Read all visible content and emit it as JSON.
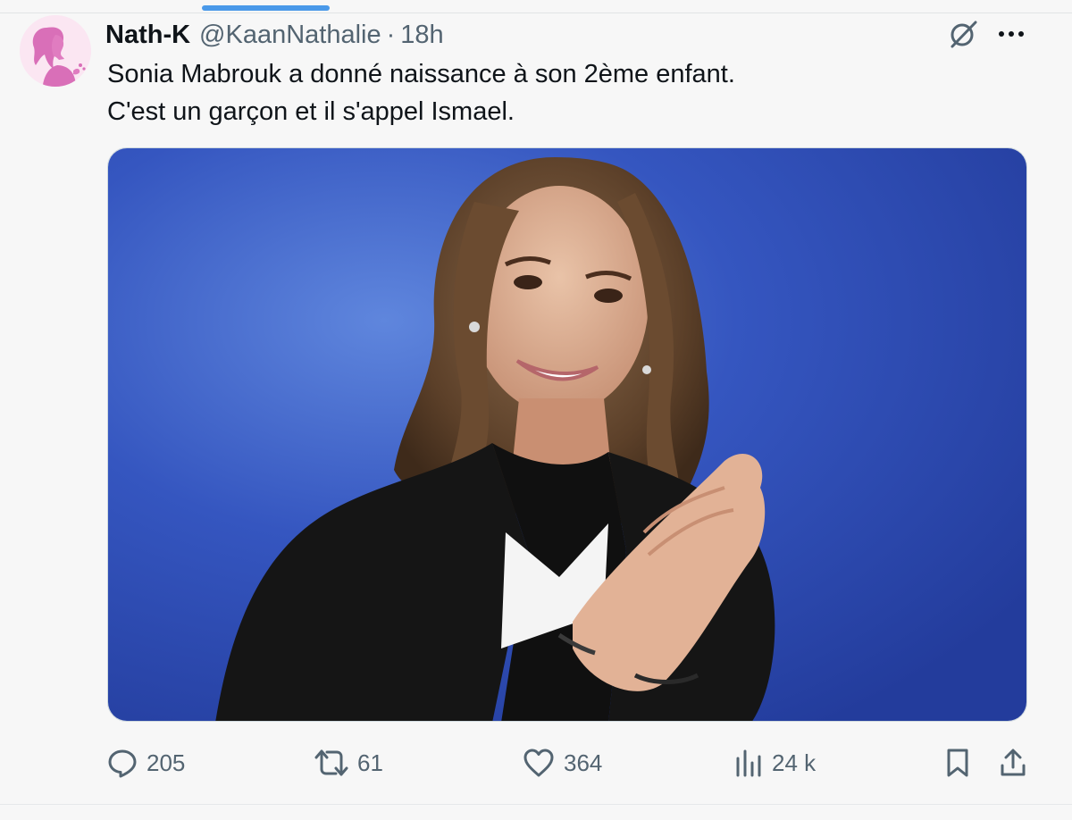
{
  "author": {
    "name": "Nath-K",
    "handle": "@KaanNathalie",
    "separator": "·",
    "time": "18h",
    "avatar_icon": "woman-silhouette-avatar-icon"
  },
  "tweet": {
    "lines": [
      "Sonia Mabrouk a donné naissance à son 2ème enfant.",
      "C'est un garçon et il s'appel Ismael."
    ]
  },
  "media": {
    "description_icon": "portrait-photo"
  },
  "actions": {
    "replies": "205",
    "retweets": "61",
    "likes": "364",
    "views": "24 k"
  },
  "icons": {
    "grok": "grok-icon",
    "more": "more-options-icon",
    "reply": "reply-icon",
    "retweet": "retweet-icon",
    "like": "heart-icon",
    "views": "analytics-icon",
    "bookmark": "bookmark-icon",
    "share": "share-icon"
  },
  "colors": {
    "accent": "#4a99e9",
    "text_primary": "#0f1419",
    "text_secondary": "#536471",
    "background": "#f7f7f7",
    "photo_backdrop": "#2f4fb8",
    "avatar_pink": "#d96fb8"
  }
}
